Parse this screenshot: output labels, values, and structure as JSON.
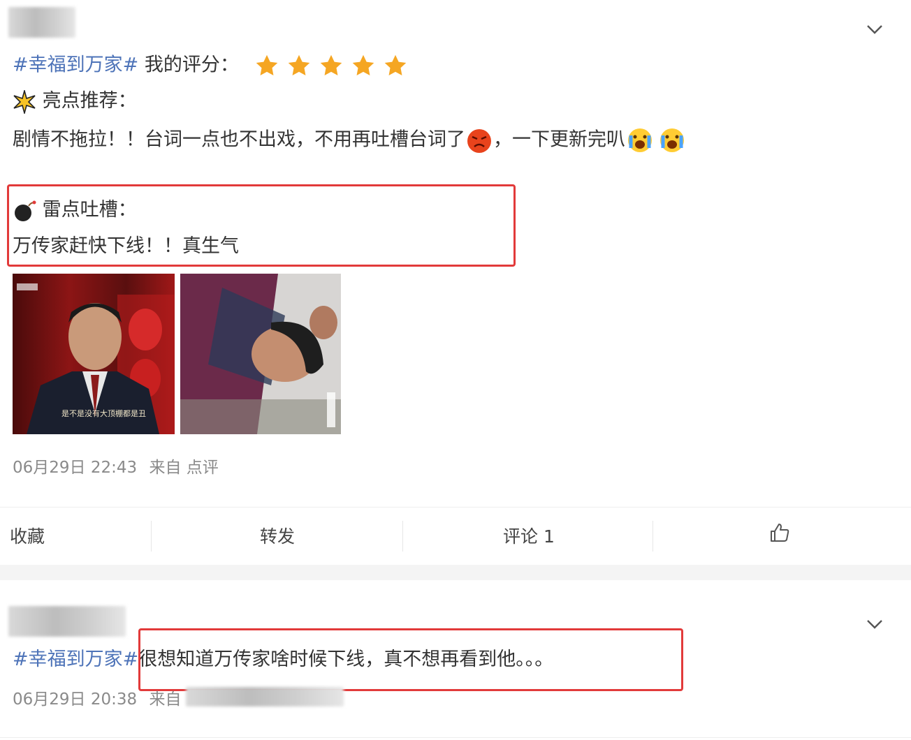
{
  "post1": {
    "hashtag": "#幸福到万家#",
    "rating_label": "我的评分：",
    "rating_stars": 5,
    "rating_max": 5,
    "highlight_heading": "亮点推荐：",
    "highlight_text": "剧情不拖拉！！台词一点也不出戏，不用再吐槽台词了",
    "highlight_text_2": "，一下更新完叭",
    "complaint_heading": "雷点吐槽：",
    "complaint_text": "万传家赶快下线！！真生气",
    "photo1_caption": "是不是没有大顶棚都是丑",
    "timestamp": "06月29日 22:43",
    "source": "来自 点评"
  },
  "actions": {
    "favorite": "收藏",
    "repost": "转发",
    "comment": "评论 1"
  },
  "post2": {
    "hashtag": "#幸福到万家#",
    "text": "很想知道万传家啥时候下线，真不想再看到他。。。",
    "timestamp": "06月29日 20:38",
    "source": "来自"
  },
  "colors": {
    "hashtag": "#4d73b8",
    "star": "#f5a623",
    "highlight_box": "#e23a3a",
    "meta_text": "#8a8a8a"
  },
  "icons": [
    "chevron-down-icon",
    "star-icon",
    "sparkle-icon",
    "angry-face-icon",
    "crying-face-icon",
    "bomb-icon",
    "thumbs-up-icon"
  ]
}
